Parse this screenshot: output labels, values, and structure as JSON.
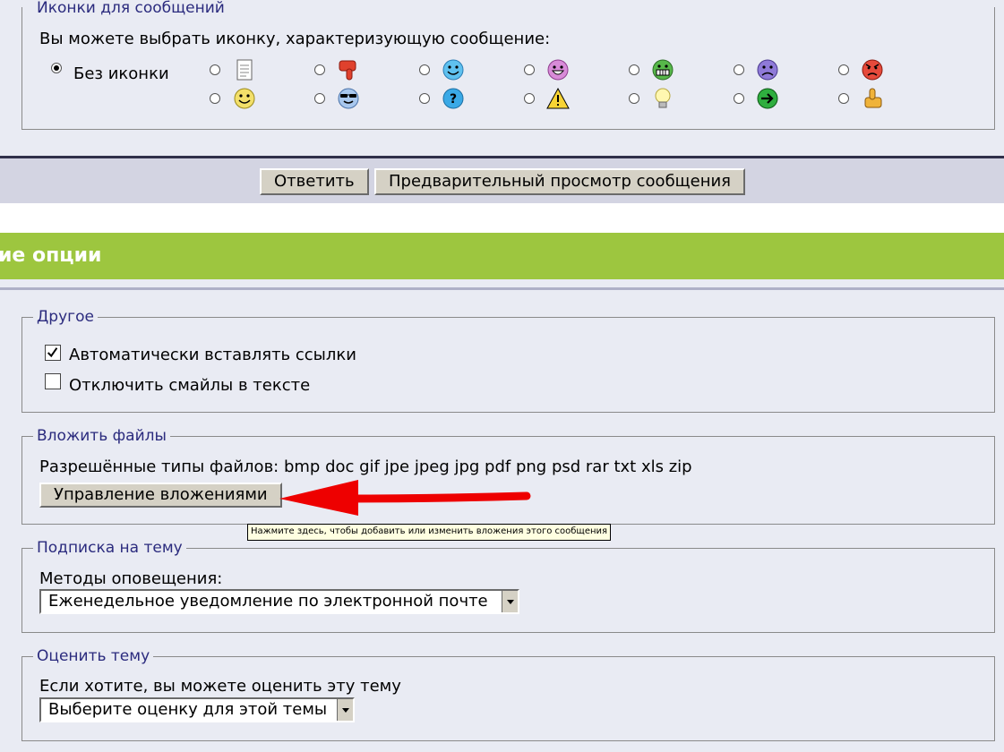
{
  "icons_section": {
    "legend": "Иконки для сообщений",
    "prompt": "Вы можете выбрать иконку, характеризующую сообщение:",
    "no_icon_label": "Без иконки",
    "icons_row1": [
      "note-icon",
      "thumbs-down-icon",
      "smile-blue-icon",
      "happy-purple-icon",
      "grin-icon",
      "sad-icon",
      "angry-icon"
    ],
    "icons_row2": [
      "smile-icon",
      "cool-icon",
      "question-icon",
      "warning-icon",
      "lightbulb-icon",
      "arrow-right-icon",
      "thumbs-up-icon"
    ]
  },
  "buttons": {
    "reply": "Ответить",
    "preview": "Предварительный просмотр сообщения"
  },
  "options_header": "ие опции",
  "other": {
    "legend": "Другое",
    "auto_links": "Автоматически вставлять ссылки",
    "auto_links_checked": true,
    "disable_smilies": "Отключить смайлы в тексте",
    "disable_smilies_checked": false
  },
  "attach": {
    "legend": "Вложить файлы",
    "allowed_types": "Разрешённые типы файлов: bmp doc gif jpe jpeg jpg pdf png psd rar txt xls zip",
    "manage_button": "Управление вложениями",
    "tooltip": "Нажмите здесь, чтобы добавить или изменить вложения этого сообщения"
  },
  "subscribe": {
    "legend": "Подписка на тему",
    "methods_label": "Методы оповещения:",
    "selected": "Еженедельное уведомление по электронной почте"
  },
  "rate": {
    "legend": "Оценить тему",
    "prompt": "Если хотите, вы можете оценить эту тему",
    "selected": "Выберите оценку для этой темы"
  },
  "colors": {
    "header_green": "#9dc63f",
    "legend_blue": "#2b2b7e",
    "arrow_red": "#ee0000"
  }
}
